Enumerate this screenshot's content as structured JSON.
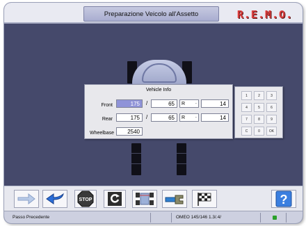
{
  "header": {
    "title": "Preparazione Veicolo all'Assetto",
    "brand": "R.E.M.O."
  },
  "vehicle_info": {
    "title": "Vehicle Info",
    "front": {
      "label": "Front",
      "width": "175",
      "sep": "/",
      "aspect": "65",
      "construction": "R",
      "dash": "-",
      "rim": "14"
    },
    "rear": {
      "label": "Rear",
      "width": "175",
      "sep": "/",
      "aspect": "65",
      "construction": "R",
      "dash": "-",
      "rim": "14"
    },
    "wheelbase": {
      "label": "Wheelbase",
      "value": "2540"
    }
  },
  "keypad": {
    "keys": [
      "1",
      "2",
      "3",
      "4",
      "5",
      "6",
      "7",
      "8",
      "9",
      "C",
      "0",
      "OK"
    ]
  },
  "toolbar": {
    "buttons": [
      {
        "name": "forward-arrow",
        "icon": "arrow-right-icon"
      },
      {
        "name": "back-arrow",
        "icon": "arrow-back-icon"
      },
      {
        "name": "stop",
        "icon": "stop-sign-icon",
        "label": "STOP"
      },
      {
        "name": "reload",
        "icon": "refresh-icon"
      },
      {
        "name": "car-layout",
        "icon": "car-wheels-icon"
      },
      {
        "name": "tool",
        "icon": "wrench-tool-icon"
      },
      {
        "name": "finish",
        "icon": "checkered-flag-icon"
      },
      {
        "name": "help",
        "icon": "question-icon",
        "label": "?"
      }
    ]
  },
  "status": {
    "left": "Passo Precedente",
    "model": "OMEO 145/146 1.3/.4/",
    "indicator_color": "#2aa02a"
  },
  "colors": {
    "background": "#45496b",
    "brand_red": "#d43b3b",
    "selected_field": "#8f93d8"
  }
}
